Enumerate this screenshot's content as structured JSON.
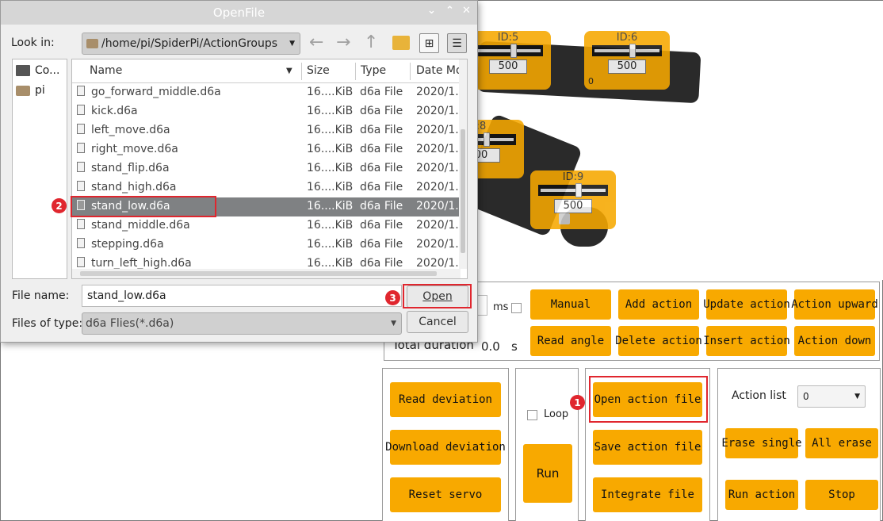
{
  "dialog": {
    "title": "OpenFile",
    "titlebar_buttons": [
      "⌄",
      "⌃",
      "✕"
    ],
    "look_in_label": "Look in:",
    "path": "/home/pi/SpiderPi/ActionGroups",
    "sidebar": [
      "Co...",
      "pi"
    ],
    "columns": [
      "Name",
      "Size",
      "Type",
      "Date Mo"
    ],
    "files": [
      {
        "name": "go_forward_middle.d6a",
        "size": "16....KiB",
        "type": "d6a File",
        "date": "2020/1..."
      },
      {
        "name": "kick.d6a",
        "size": "16....KiB",
        "type": "d6a File",
        "date": "2020/1..."
      },
      {
        "name": "left_move.d6a",
        "size": "16....KiB",
        "type": "d6a File",
        "date": "2020/1..."
      },
      {
        "name": "right_move.d6a",
        "size": "16....KiB",
        "type": "d6a File",
        "date": "2020/1..."
      },
      {
        "name": "stand_flip.d6a",
        "size": "16....KiB",
        "type": "d6a File",
        "date": "2020/1..."
      },
      {
        "name": "stand_high.d6a",
        "size": "16....KiB",
        "type": "d6a File",
        "date": "2020/1..."
      },
      {
        "name": "stand_low.d6a",
        "size": "16....KiB",
        "type": "d6a File",
        "date": "2020/1..."
      },
      {
        "name": "stand_middle.d6a",
        "size": "16....KiB",
        "type": "d6a File",
        "date": "2020/1..."
      },
      {
        "name": "stepping.d6a",
        "size": "16....KiB",
        "type": "d6a File",
        "date": "2020/1..."
      },
      {
        "name": "turn_left_high.d6a",
        "size": "16....KiB",
        "type": "d6a File",
        "date": "2020/1..."
      }
    ],
    "file_name_label": "File name:",
    "file_name_value": "stand_low.d6a",
    "files_of_type_label": "Files of type:",
    "files_of_type_value": "d6a Flies(*.d6a)",
    "open_label": "Open",
    "cancel_label": "Cancel"
  },
  "servos": [
    {
      "id": "ID:5",
      "value": "500",
      "min": "0"
    },
    {
      "id": "ID:6",
      "value": "500",
      "min": "0"
    },
    {
      "id": ":8",
      "value": "00",
      "min": ""
    },
    {
      "id": "ID:9",
      "value": "500",
      "min": "0"
    }
  ],
  "edit": {
    "ms_label": "ms",
    "total_label": "Total duration",
    "total_value": "0.0",
    "total_unit": "s",
    "buttons": [
      "Manual",
      "Add action",
      "Update action",
      "Action upward",
      "Read angle",
      "Delete action",
      "Insert action",
      "Action down"
    ]
  },
  "deviation": {
    "read": "Read deviation",
    "download": "Download deviation",
    "reset": "Reset servo"
  },
  "run": {
    "loop_label": "Loop",
    "run_label": "Run"
  },
  "files_panel": {
    "open": "Open action file",
    "save": "Save action file",
    "integrate": "Integrate file"
  },
  "action_list": {
    "label": "Action list",
    "value": "0",
    "erase_single": "Erase single",
    "all_erase": "All erase",
    "run_action": "Run action",
    "stop": "Stop"
  },
  "steps": [
    "1",
    "2",
    "3"
  ],
  "colors": {
    "accent": "#f8a900",
    "highlight": "#e0262e",
    "selected_row": "#7f8183"
  }
}
